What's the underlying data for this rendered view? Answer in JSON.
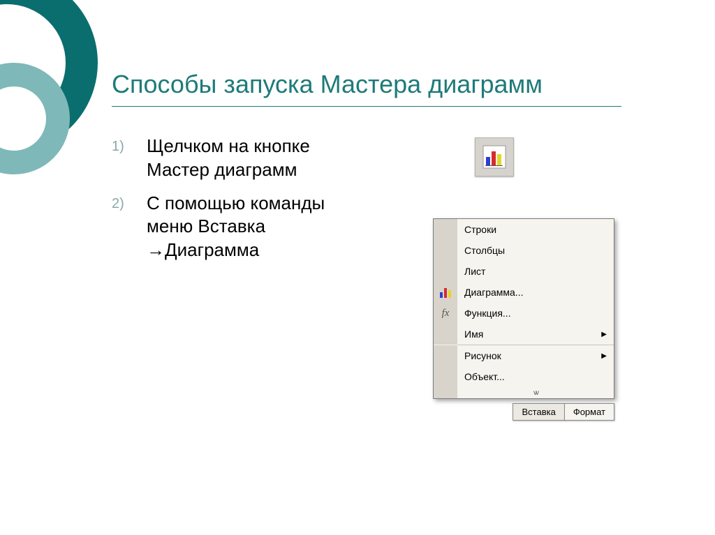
{
  "title": "Способы запуска Мастера диаграмм",
  "points": [
    {
      "num": "1)",
      "text": "Щелчком на кнопке Мастер диаграмм"
    },
    {
      "num": "2)",
      "text": "С помощью команды меню Вставка →Диаграмма"
    }
  ],
  "icons": {
    "chart_wizard": "chart-wizard-icon",
    "fx": "fx"
  },
  "menu": {
    "items": [
      {
        "label": "Строки",
        "icon": "",
        "submenu": false
      },
      {
        "label": "Столбцы",
        "icon": "",
        "submenu": false
      },
      {
        "label": "Лист",
        "icon": "",
        "submenu": false
      },
      {
        "label": "Диаграмма...",
        "icon": "chart",
        "submenu": false
      },
      {
        "label": "Функция...",
        "icon": "fx",
        "submenu": false
      },
      {
        "label": "Имя",
        "icon": "",
        "submenu": true
      },
      {
        "label": "Рисунок",
        "icon": "",
        "submenu": true
      },
      {
        "label": "Объект...",
        "icon": "",
        "submenu": false
      }
    ]
  },
  "tabs": {
    "left": "Вставка",
    "right": "Формат"
  }
}
